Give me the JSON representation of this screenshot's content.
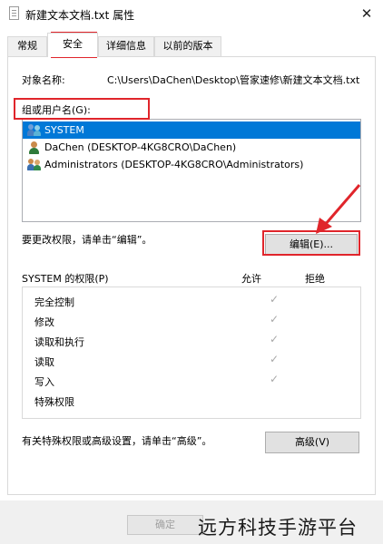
{
  "window": {
    "title": "新建文本文档.txt 属性",
    "close_glyph": "✕"
  },
  "tabs": [
    {
      "label": "常规",
      "active": false
    },
    {
      "label": "安全",
      "active": true
    },
    {
      "label": "详细信息",
      "active": false
    },
    {
      "label": "以前的版本",
      "active": false
    }
  ],
  "security": {
    "object_name_label": "对象名称:",
    "object_name_value": "C:\\Users\\DaChen\\Desktop\\管家速修\\新建文本文档.txt",
    "group_label": "组或用户名(G):",
    "users": [
      {
        "name": "SYSTEM",
        "selected": true,
        "icon": "users-group-icon"
      },
      {
        "name": "DaChen (DESKTOP-4KG8CRO\\DaChen)",
        "selected": false,
        "icon": "user-icon"
      },
      {
        "name": "Administrators (DESKTOP-4KG8CRO\\Administrators)",
        "selected": false,
        "icon": "users-group-icon"
      }
    ],
    "change_hint": "要更改权限，请单击“编辑”。",
    "edit_button": "编辑(E)...",
    "permissions_header": "SYSTEM 的权限(P)",
    "allow_header": "允许",
    "deny_header": "拒绝",
    "permissions": [
      {
        "name": "完全控制",
        "allow": true,
        "deny": false
      },
      {
        "name": "修改",
        "allow": true,
        "deny": false
      },
      {
        "name": "读取和执行",
        "allow": true,
        "deny": false
      },
      {
        "name": "读取",
        "allow": true,
        "deny": false
      },
      {
        "name": "写入",
        "allow": true,
        "deny": false
      },
      {
        "name": "特殊权限",
        "allow": false,
        "deny": false
      }
    ],
    "check_glyph": "✓",
    "advanced_hint": "有关特殊权限或高级设置，请单击“高级”。",
    "advanced_button": "高级(V)"
  },
  "footer": {
    "ok_button": "确定"
  },
  "watermark": "远方科技手游平台",
  "colors": {
    "highlight": "#e0252b",
    "selection": "#0078d7"
  }
}
